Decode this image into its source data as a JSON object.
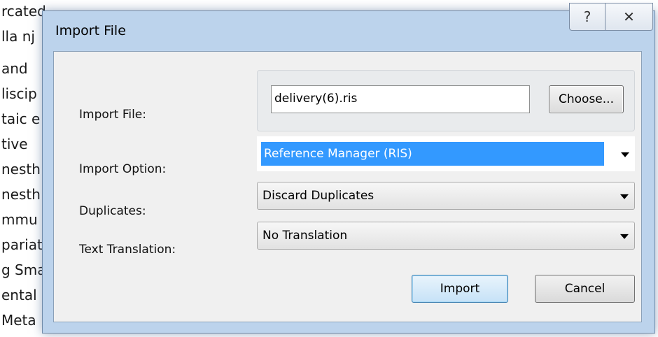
{
  "background": {
    "lines": [
      "rcated",
      "lla nj",
      "and",
      "liscip",
      "taic e",
      "tive",
      "nesth",
      "nesth",
      "mmu",
      "pariat",
      "g Sma",
      "ental",
      "Meta"
    ]
  },
  "dialog": {
    "title": "Import File",
    "help_label": "?",
    "close_label": "✕"
  },
  "form": {
    "import_file": {
      "label": "Import File:",
      "value": "delivery(6).ris",
      "choose_label": "Choose..."
    },
    "import_option": {
      "label": "Import Option:",
      "value": "Reference Manager (RIS)"
    },
    "duplicates": {
      "label": "Duplicates:",
      "value": "Discard Duplicates"
    },
    "text_translation": {
      "label": "Text Translation:",
      "value": "No Translation"
    }
  },
  "buttons": {
    "import_label": "Import",
    "cancel_label": "Cancel"
  },
  "colors": {
    "selection": "#3399ff",
    "dialog_frame": "#bcd3ec"
  }
}
